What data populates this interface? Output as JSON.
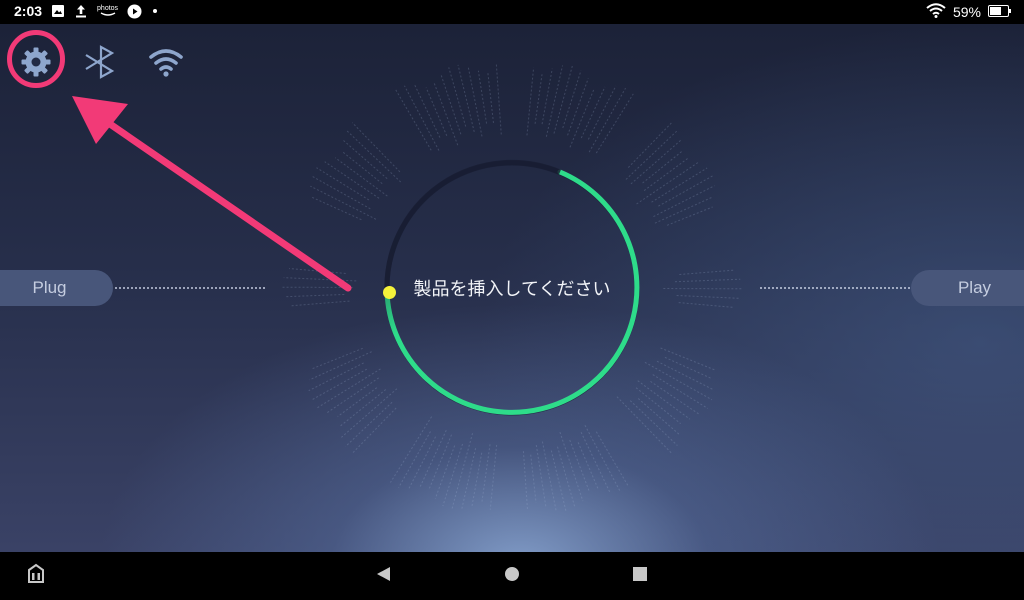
{
  "status_bar": {
    "time": "2:03",
    "notification_icons": [
      "image-icon",
      "upload-icon",
      "amazon-photos-icon",
      "play-icon",
      "dot-icon"
    ],
    "amazon_photos_label": "photos",
    "battery": "59%"
  },
  "toolbar": {
    "icons": [
      "gear-icon",
      "bluetooth-icon",
      "wifi-icon"
    ],
    "highlight_color": "#f23a77"
  },
  "main": {
    "left_button": "Plug",
    "right_button": "Play",
    "prompt": "製品を挿入してください",
    "ring_color": "#2edc8a",
    "indicator_color": "#f5f23a"
  },
  "nav_bar": {
    "buttons": [
      "toolbox-icon",
      "back-icon",
      "home-icon",
      "recents-icon"
    ]
  }
}
